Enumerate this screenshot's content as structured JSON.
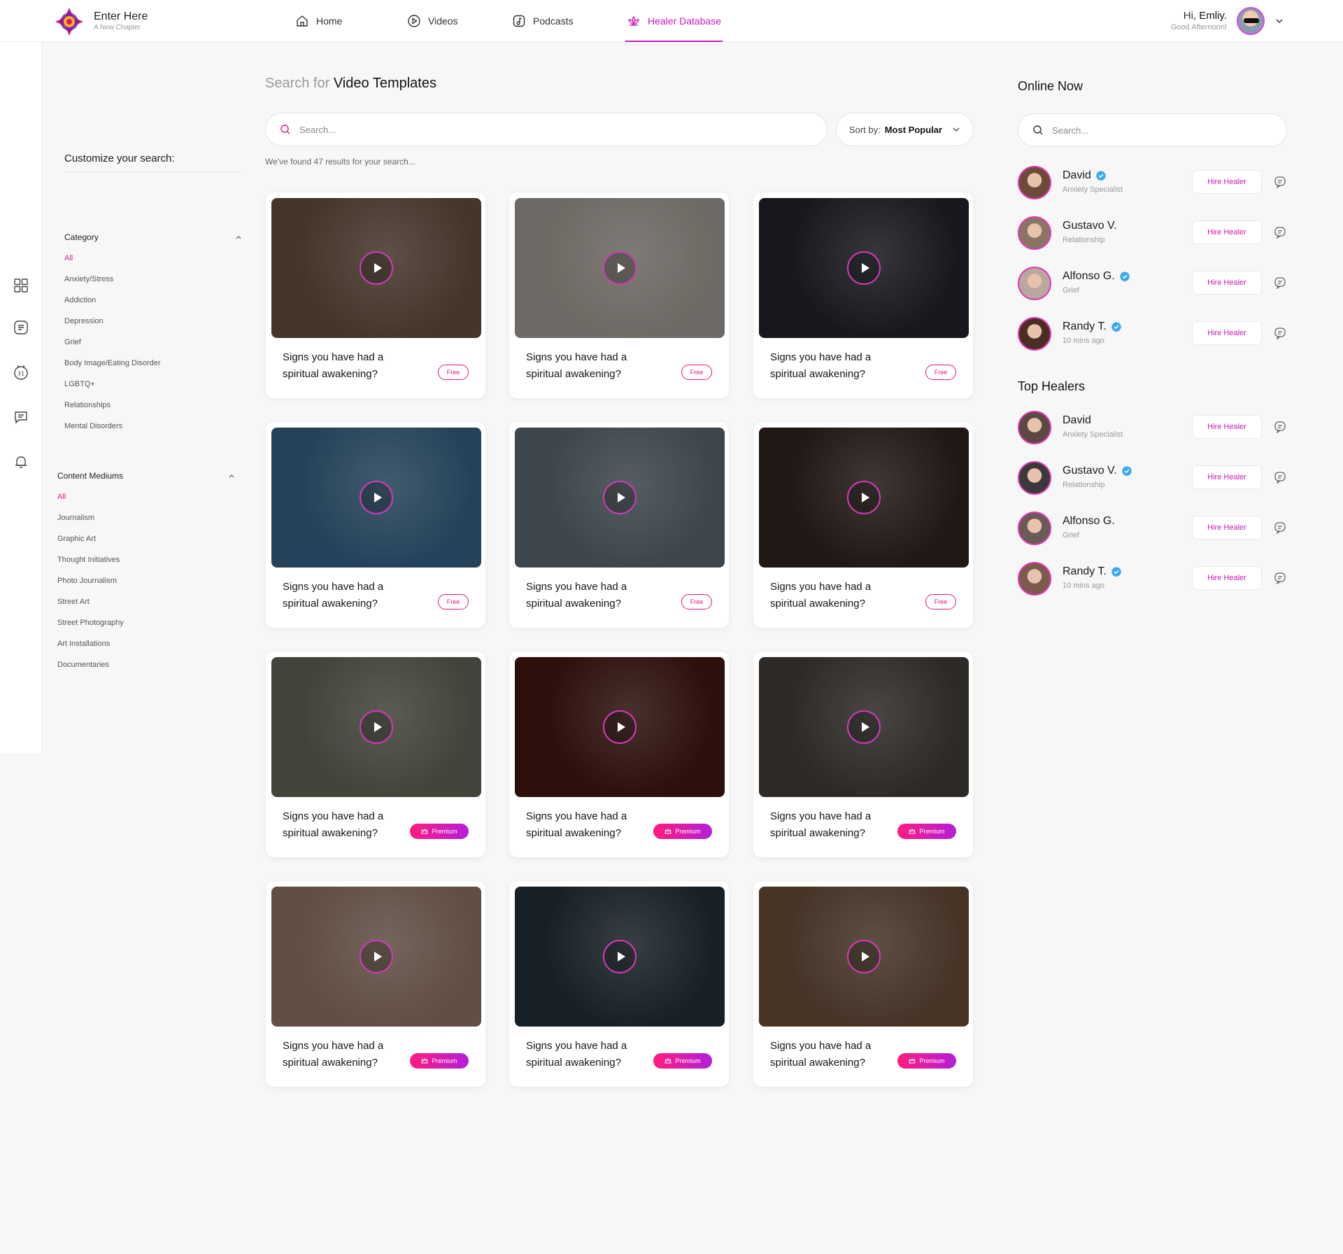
{
  "brand": {
    "title": "Enter Here",
    "subtitle": "A New Chapter"
  },
  "nav": [
    {
      "label": "Home",
      "icon": "home-icon"
    },
    {
      "label": "Videos",
      "icon": "play-circle-icon"
    },
    {
      "label": "Podcasts",
      "icon": "music-note-icon"
    },
    {
      "label": "Healer Database",
      "icon": "lotus-icon",
      "active": true
    }
  ],
  "user": {
    "greeting": "Hi,",
    "name": "Emliy.",
    "subtitle": "Good Afternoon!"
  },
  "rail_icons": [
    "grid-icon",
    "list-icon",
    "calendar-icon",
    "chat-icon",
    "bell-icon"
  ],
  "rail_calendar_day": "31",
  "filters": {
    "title": "Customize your search:",
    "category": {
      "label": "Category",
      "items": [
        "All",
        "Anxiety/Stress",
        "Addiction",
        "Depression",
        "Grief",
        "Body Image/Eating Disorder",
        "LGBTQ+",
        "Relationships",
        "Mental Disorders"
      ]
    },
    "mediums": {
      "label": "Content Mediums",
      "items": [
        "All",
        "Journalism",
        "Graphic Art",
        "Thought Initiatives",
        "Photo Journalism",
        "Street Art",
        "Street Photography",
        "Art Installations",
        "Documentaries"
      ]
    }
  },
  "main": {
    "title_prefix": "Search for",
    "title_main": "Video Templates",
    "search_placeholder": "Search...",
    "sort_label": "Sort by:",
    "sort_value": "Most Popular",
    "results_text": "We've found 47 results for your search..."
  },
  "cards": [
    {
      "line1": "Signs you have had a",
      "line2": "spiritual awakening?",
      "badge": "Free",
      "bg": "#5a4538"
    },
    {
      "line1": "Signs you have had a",
      "line2": "spiritual awakening?",
      "badge": "Free",
      "bg": "#8d8780"
    },
    {
      "line1": "Signs you have had a",
      "line2": "spiritual awakening?",
      "badge": "Free",
      "bg": "#1d1f26"
    },
    {
      "line1": "Signs you have had a",
      "line2": "spiritual awakening?",
      "badge": "Free",
      "bg": "#2f5674"
    },
    {
      "line1": "Signs you have had a",
      "line2": "spiritual awakening?",
      "badge": "Free",
      "bg": "#4e5a62"
    },
    {
      "line1": "Signs you have had a",
      "line2": "spiritual awakening?",
      "badge": "Free",
      "bg": "#2b1f1c"
    },
    {
      "line1": "Signs you have had a",
      "line2": "spiritual awakening?",
      "badge": "Premium",
      "bg": "#56574a"
    },
    {
      "line1": "Signs you have had a",
      "line2": "spiritual awakening?",
      "badge": "Premium",
      "bg": "#3a1410"
    },
    {
      "line1": "Signs you have had a",
      "line2": "spiritual awakening?",
      "badge": "Premium",
      "bg": "#3a3632"
    },
    {
      "line1": "Signs you have had a",
      "line2": "spiritual awakening?",
      "badge": "Premium",
      "bg": "#7d6558"
    },
    {
      "line1": "Signs you have had a",
      "line2": "spiritual awakening?",
      "badge": "Premium",
      "bg": "#1f2a32"
    },
    {
      "line1": "Signs you have had a",
      "line2": "spiritual awakening?",
      "badge": "Premium",
      "bg": "#5a4433"
    }
  ],
  "online": {
    "title": "Online Now",
    "search_placeholder": "Search...",
    "healers": [
      {
        "name": "David",
        "role": "Anxiety Specialist",
        "verified": true,
        "avatar": "#6e4a3a"
      },
      {
        "name": "Gustavo V.",
        "role": "Relationship",
        "verified": false,
        "avatar": "#8a7466"
      },
      {
        "name": "Alfonso G.",
        "role": "Grief",
        "verified": true,
        "avatar": "#b9a7a0"
      },
      {
        "name": "Randy T.",
        "role": "10 mins ago",
        "verified": true,
        "avatar": "#4a2e24"
      }
    ]
  },
  "top": {
    "title": "Top Healers",
    "healers": [
      {
        "name": "David",
        "role": "Anxiety Specialist",
        "verified": false,
        "avatar": "#5b4a44"
      },
      {
        "name": "Gustavo V.",
        "role": "Relationship",
        "verified": true,
        "avatar": "#3a3a3a"
      },
      {
        "name": "Alfonso G.",
        "role": "Grief",
        "verified": false,
        "avatar": "#6a5a58"
      },
      {
        "name": "Randy T.",
        "role": "10 mins ago",
        "verified": true,
        "avatar": "#7a5b4e"
      }
    ]
  },
  "hire_label": "Hire Healer",
  "colors": {
    "accent": "#c81bb4",
    "pink": "#e0197e",
    "verified": "#3aa8f0"
  }
}
